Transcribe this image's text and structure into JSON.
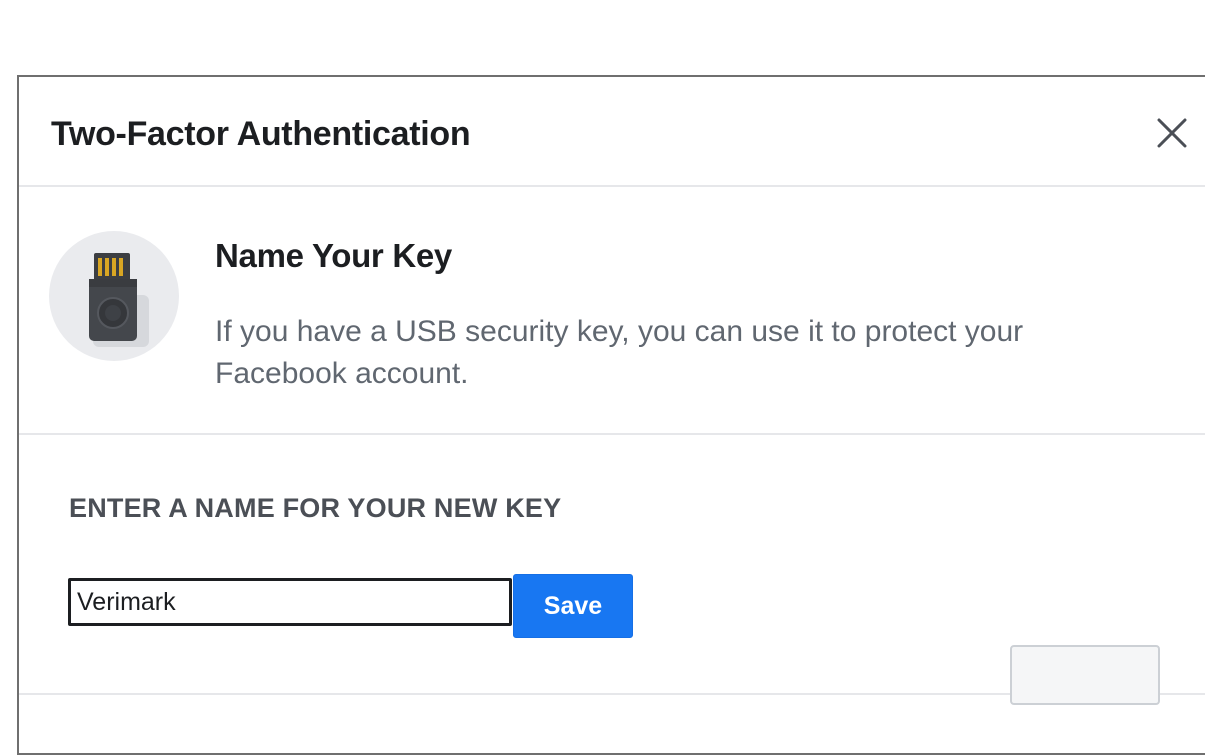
{
  "dialog": {
    "title": "Two-Factor Authentication",
    "close_icon": "close-icon"
  },
  "intro": {
    "illustration_icon": "usb-security-key-icon",
    "title": "Name Your Key",
    "description": "If you have a USB security key, you can use it to protect your Facebook account."
  },
  "form": {
    "label": "ENTER A NAME FOR YOUR NEW KEY",
    "key_name_value": "Verimark",
    "save_label": "Save"
  },
  "colors": {
    "accent": "#1877f2",
    "title_text": "#1c1e21",
    "secondary_text": "#606770",
    "divider": "#e6e7ea"
  }
}
